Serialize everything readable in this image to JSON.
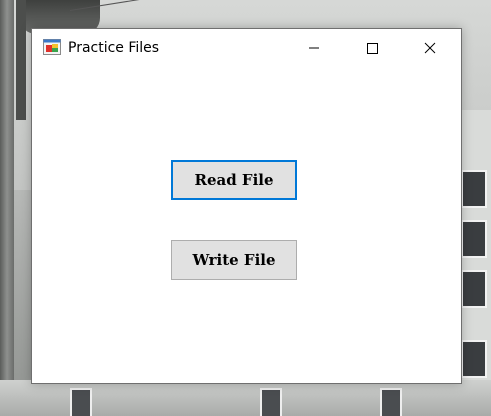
{
  "window": {
    "title": "Practice Files",
    "icon": "winforms-app-icon",
    "controls": {
      "minimize": "minimize-icon",
      "maximize": "maximize-icon",
      "close": "close-icon"
    }
  },
  "form": {
    "read_button": "Read File",
    "write_button": "Write File"
  },
  "colors": {
    "focus_border": "#0078d7",
    "button_face": "#e1e1e1",
    "button_border": "#adadad",
    "window_bg": "#ffffff"
  }
}
